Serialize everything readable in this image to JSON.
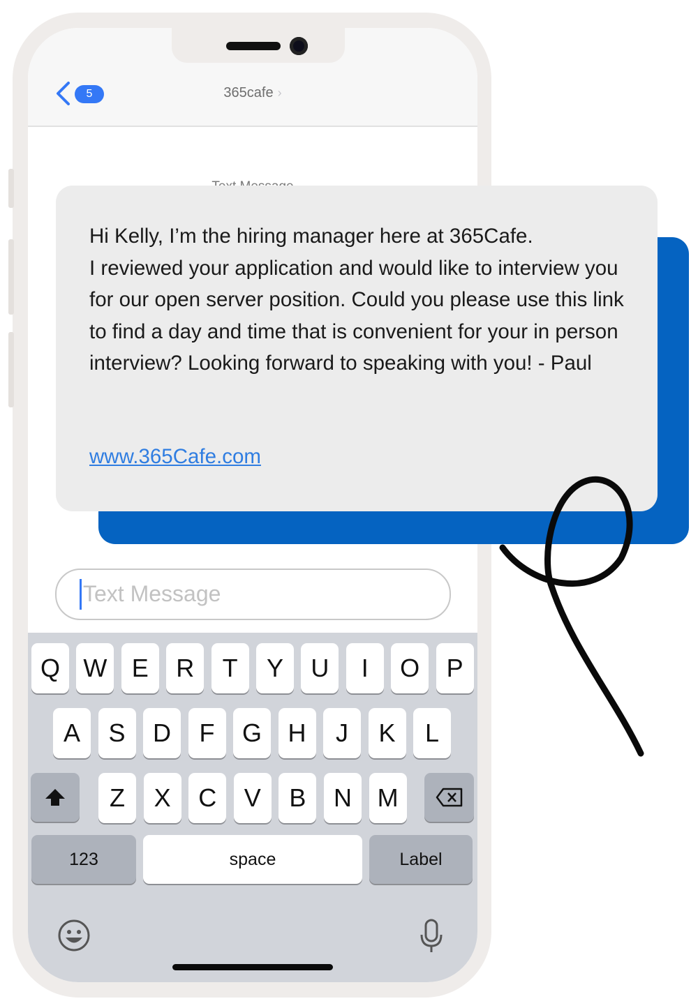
{
  "header": {
    "back_badge": "5",
    "contact_name": "365cafe"
  },
  "conversation": {
    "label": "Text Message",
    "message": {
      "text": "Hi Kelly, I’m the hiring manager here at 365Cafe.\nI reviewed your application and would like to interview you for our open server position. Could you please use this link to find a day and time that is convenient for your in person interview? Looking forward to speaking with you! - Paul",
      "link": "www.365Cafe.com"
    }
  },
  "composer": {
    "placeholder": "Text Message"
  },
  "keyboard": {
    "row1": [
      "Q",
      "W",
      "E",
      "R",
      "T",
      "Y",
      "U",
      "I",
      "O",
      "P"
    ],
    "row2": [
      "A",
      "S",
      "D",
      "F",
      "G",
      "H",
      "J",
      "K",
      "L"
    ],
    "row3": [
      "Z",
      "X",
      "C",
      "V",
      "B",
      "N",
      "M"
    ],
    "numbers_label": "123",
    "space_label": "space",
    "return_label": "Label"
  },
  "icons": {
    "back": "chevron-left-icon",
    "shift": "shift-arrow-icon",
    "delete": "backspace-icon",
    "emoji": "emoji-icon",
    "mic": "microphone-icon"
  },
  "colors": {
    "accent_blue": "#3478f6",
    "card_blue": "#0563c1",
    "bubble_gray": "#ececec",
    "link_blue": "#2f7de1"
  }
}
